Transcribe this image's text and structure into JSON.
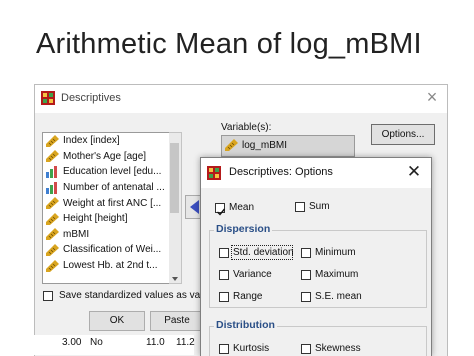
{
  "slide": {
    "title": "Arithmetic Mean of log_mBMI"
  },
  "descriptives": {
    "title": "Descriptives",
    "variables_label": "Variable(s):",
    "variables": [
      "log_mBMI"
    ],
    "options_button": "Options...",
    "source_list": [
      {
        "label": "Index [index]",
        "icon": "scale-icon"
      },
      {
        "label": "Mother's Age [age]",
        "icon": "scale-icon"
      },
      {
        "label": "Education level [edu...",
        "icon": "ordinal-icon"
      },
      {
        "label": "Number of antenatal ...",
        "icon": "ordinal-icon"
      },
      {
        "label": "Weight at first ANC [...",
        "icon": "scale-icon"
      },
      {
        "label": "Height [height]",
        "icon": "scale-icon"
      },
      {
        "label": "mBMI",
        "icon": "scale-icon"
      },
      {
        "label": "Classification of Wei...",
        "icon": "scale-icon"
      },
      {
        "label": "Lowest Hb. at 2nd t...",
        "icon": "scale-icon"
      }
    ],
    "save_std_label": "Save standardized values as var",
    "ok_button": "OK",
    "paste_button": "Paste",
    "underlying_row": {
      "c1": "3.00",
      "c2": "No",
      "c3": "11.0",
      "c4": "11.2"
    }
  },
  "options": {
    "title": "Descriptives: Options",
    "mean_label": "Mean",
    "mean_checked": true,
    "sum_label": "Sum",
    "dispersion_title": "Dispersion",
    "std_dev_label": "Std. deviation",
    "minimum_label": "Minimum",
    "variance_label": "Variance",
    "maximum_label": "Maximum",
    "range_label": "Range",
    "se_mean_label": "S.E. mean",
    "distribution_title": "Distribution",
    "kurtosis_label": "Kurtosis",
    "skewness_label": "Skewness"
  }
}
